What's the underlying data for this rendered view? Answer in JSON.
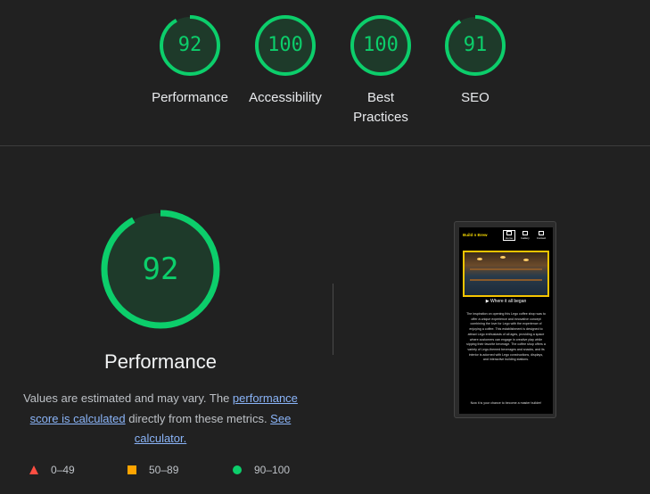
{
  "colors": {
    "pass": "#0cce6b",
    "average": "#ffa400",
    "fail": "#ff4e42",
    "link": "#8ab4f8"
  },
  "gauges": [
    {
      "score": "92",
      "label": "Performance",
      "value": 0.92
    },
    {
      "score": "100",
      "label": "Accessibility",
      "value": 1.0
    },
    {
      "score": "100",
      "label": "Best Practices",
      "value": 1.0
    },
    {
      "score": "91",
      "label": "SEO",
      "value": 0.91
    }
  ],
  "main": {
    "score": "92",
    "value": 0.92,
    "title": "Performance",
    "desc_prefix": "Values are estimated and may vary. The ",
    "desc_link1": "performance score is calculated",
    "desc_mid": " directly from these metrics. ",
    "desc_link2": "See calculator."
  },
  "legend": [
    {
      "icon": "red-triangle-icon",
      "range": "0–49"
    },
    {
      "icon": "orange-square-icon",
      "range": "50–89"
    },
    {
      "icon": "green-circle-icon",
      "range": "90–100"
    }
  ],
  "thumbnail": {
    "brand": "Build n Brew",
    "nav": [
      "Home",
      "Gallery",
      "Contact"
    ],
    "subheading": "Where it all began",
    "paragraph": "The inspiration on opening this Lego coffee shop was to offer a unique experience and innovative concept combining the love for Lego with the experience of enjoying a coffee. This establishment is designed to attract Lego enthusiasts of all ages, providing a space where customers can engage in creative play while sipping their favorite beverage. The coffee shop offers a variety of Lego-themed beverages and snacks, and its interior is adorned with Lego constructions, displays, and interactive building stations.",
    "cta": "Now it is your chance to become a master builder!"
  }
}
